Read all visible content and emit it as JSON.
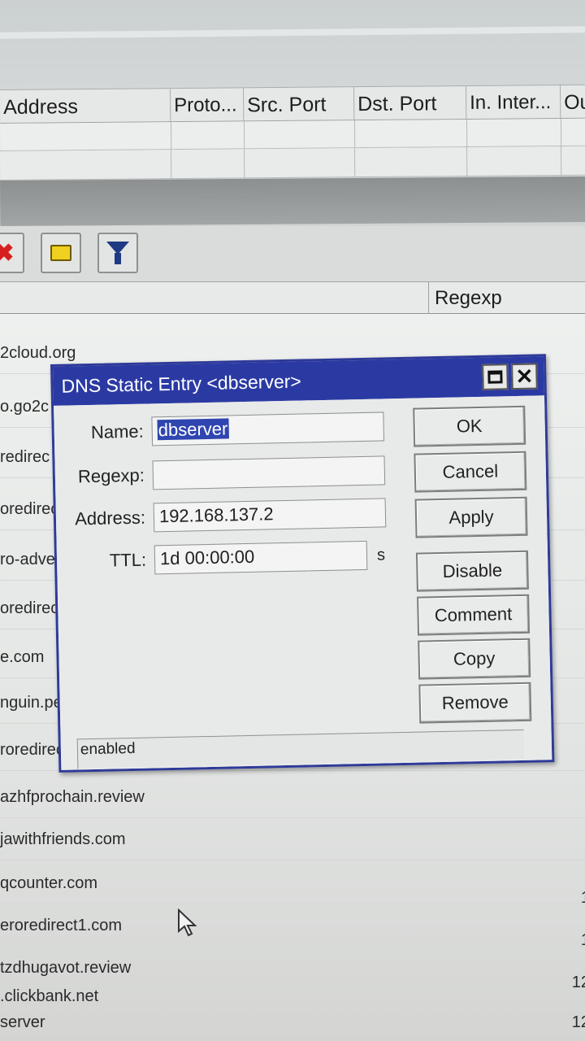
{
  "firewall_table": {
    "columns": [
      "Address",
      "Proto...",
      "Src. Port",
      "Dst. Port",
      "In. Inter...",
      "Ou"
    ]
  },
  "toolbar": {
    "remove_icon": "x-icon",
    "comment_icon": "note-icon",
    "filter_icon": "filter-icon"
  },
  "dns_list": {
    "header_regexp": "Regexp",
    "rows": [
      {
        "name": "2cloud.org",
        "ttl": ""
      },
      {
        "name": "o.go2c",
        "ttl": ""
      },
      {
        "name": "redirec",
        "ttl": ""
      },
      {
        "name": "oredirec",
        "ttl": ""
      },
      {
        "name": "ro-adve",
        "ttl": ""
      },
      {
        "name": "oredirec",
        "ttl": ""
      },
      {
        "name": "e.com",
        "ttl": ""
      },
      {
        "name": "nguin.pe",
        "ttl": ""
      },
      {
        "name": "roredirec",
        "ttl": ""
      },
      {
        "name": "azhfprochain.review",
        "ttl": ""
      },
      {
        "name": "jawithfriends.com",
        "ttl": ""
      },
      {
        "name": "qcounter.com",
        "ttl": "1"
      },
      {
        "name": "eroredirect1.com",
        "ttl": "1"
      },
      {
        "name": "tzdhugavot.review",
        "ttl": "12"
      },
      {
        "name": ".clickbank.net",
        "ttl": ""
      },
      {
        "name": "server",
        "ttl": "12"
      }
    ]
  },
  "dialog": {
    "title": "DNS Static Entry <dbserver>",
    "fields": {
      "name_label": "Name:",
      "name_value": "dbserver",
      "regexp_label": "Regexp:",
      "regexp_value": "",
      "address_label": "Address:",
      "address_value": "192.168.137.2",
      "ttl_label": "TTL:",
      "ttl_value": "1d 00:00:00",
      "ttl_unit": "s"
    },
    "buttons": {
      "ok": "OK",
      "cancel": "Cancel",
      "apply": "Apply",
      "disable": "Disable",
      "comment": "Comment",
      "copy": "Copy",
      "remove": "Remove"
    },
    "status": "enabled"
  }
}
